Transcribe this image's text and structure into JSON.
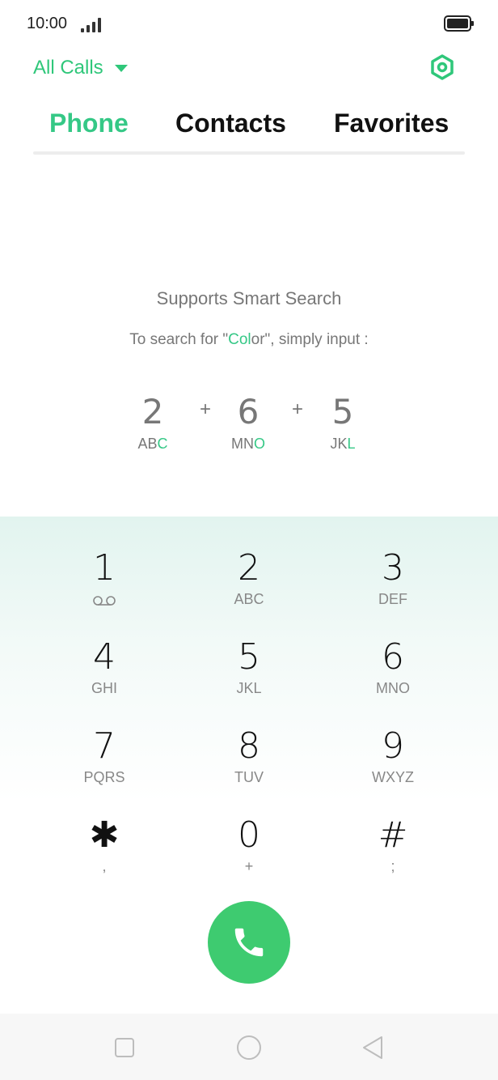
{
  "status_bar": {
    "time": "10:00",
    "signal_icon": "signal-bars-icon",
    "battery_icon": "battery-full-icon"
  },
  "header": {
    "filter_label": "All Calls",
    "filter_icon": "caret-down-icon",
    "settings_icon": "settings-hexagon-icon"
  },
  "tabs": [
    {
      "label": "Phone",
      "active": true
    },
    {
      "label": "Contacts",
      "active": false
    },
    {
      "label": "Favorites",
      "active": false
    }
  ],
  "smart_search": {
    "title": "Supports Smart Search",
    "subtitle_before": "To search for \"",
    "subtitle_highlight": "Col",
    "subtitle_after": "or\", simply input :",
    "example": [
      {
        "digit": "2",
        "letters_plain": "AB",
        "letters_hl": "C"
      },
      {
        "digit": "6",
        "letters_plain": "MN",
        "letters_hl": "O"
      },
      {
        "digit": "5",
        "letters_plain": "JK",
        "letters_hl": "L"
      }
    ],
    "plus": "+"
  },
  "keypad": {
    "keys": [
      {
        "digit": "1",
        "letters": "",
        "icon": "voicemail-icon"
      },
      {
        "digit": "2",
        "letters": "ABC"
      },
      {
        "digit": "3",
        "letters": "DEF"
      },
      {
        "digit": "4",
        "letters": "GHI"
      },
      {
        "digit": "5",
        "letters": "JKL"
      },
      {
        "digit": "6",
        "letters": "MNO"
      },
      {
        "digit": "7",
        "letters": "PQRS"
      },
      {
        "digit": "8",
        "letters": "TUV"
      },
      {
        "digit": "9",
        "letters": "WXYZ"
      },
      {
        "digit": "✱",
        "letters": ","
      },
      {
        "digit": "0",
        "letters": "+"
      },
      {
        "digit": "#",
        "letters": ";"
      }
    ]
  },
  "call_button": {
    "icon": "phone-handset-icon",
    "color": "#3ecb70"
  },
  "navbar": {
    "recents_icon": "square-icon",
    "home_icon": "circle-icon",
    "back_icon": "triangle-back-icon"
  },
  "colors": {
    "accent": "#35c886",
    "call_green": "#3ecb70"
  }
}
